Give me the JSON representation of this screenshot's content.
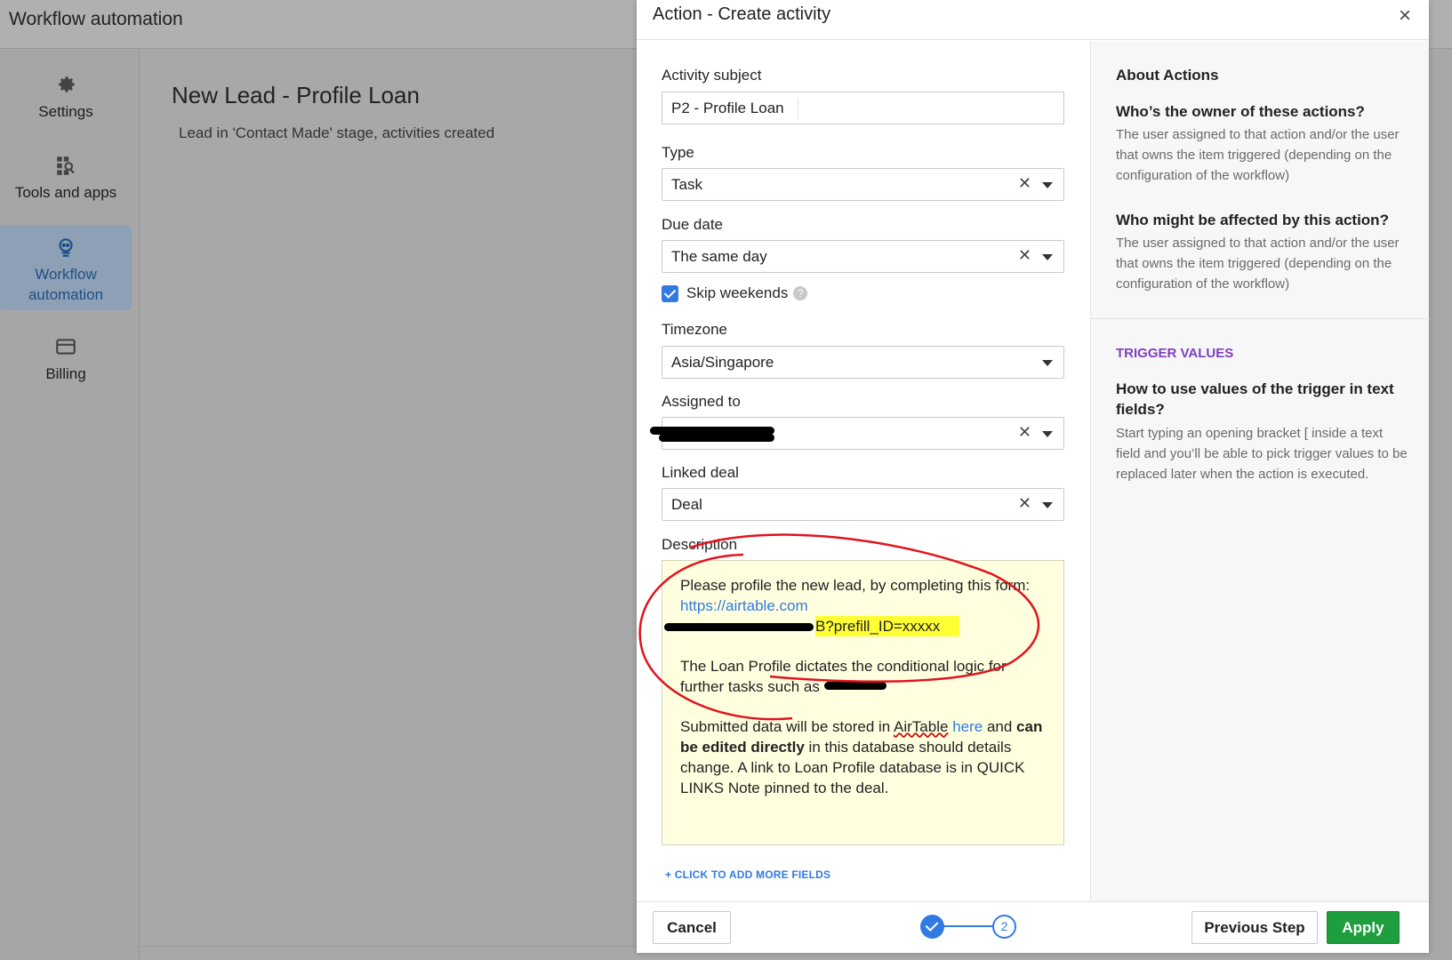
{
  "app": {
    "title": "Workflow automation"
  },
  "sidebar": {
    "items": [
      {
        "label": "Settings",
        "icon": "gear-icon"
      },
      {
        "label": "Tools and apps",
        "icon": "tools-icon"
      },
      {
        "label": "Workflow\nautomation",
        "icon": "workflow-icon",
        "active": true
      },
      {
        "label": "Billing",
        "icon": "card-icon"
      }
    ]
  },
  "main": {
    "title": "New Lead - Profile Loan",
    "subtitle": "Lead in 'Contact Made' stage, activities created"
  },
  "modal": {
    "title": "Action - Create activity",
    "close": "×",
    "form": {
      "subject_label": "Activity subject",
      "subject_value": "P2 - Profile Loan",
      "type_label": "Type",
      "type_value": "Task",
      "due_label": "Due date",
      "due_value": "The same day",
      "skip_label": "Skip weekends",
      "skip_checked": true,
      "timezone_label": "Timezone",
      "timezone_value": "Asia/Singapore",
      "assigned_label": "Assigned to",
      "linked_label": "Linked deal",
      "linked_value": "Deal",
      "desc_label": "Description",
      "desc_line1": "Please profile the new lead, by completing this form:",
      "desc_link": "https://airtable.com",
      "desc_highlight": "B?prefill_ID=xxxxx",
      "desc_para2": "The Loan Profile dictates the conditional logic for further tasks such as",
      "desc_para3_a": "Submitted data will be stored in ",
      "desc_para3_airtable": "AirTable",
      "desc_para3_here": "here",
      "desc_para3_b": " and ",
      "desc_para3_bold": "can be edited directly",
      "desc_para3_c": " in this database should details change. A link to Loan Profile database is in QUICK LINKS Note pinned to the deal.",
      "add_more": "+ CLICK TO ADD MORE FIELDS"
    },
    "about": {
      "heading": "About Actions",
      "q1": "Who’s the owner of these actions?",
      "a1": "The user assigned to that action and/or the user that owns the item triggered (depending on the configuration of the workflow)",
      "q2": "Who might be affected by this action?",
      "a2": "The user assigned to that action and/or the user that owns the item triggered (depending on the configuration of the workflow)",
      "trigger_heading": "TRIGGER VALUES",
      "q3": "How to use values of the trigger in text fields?",
      "a3": "Start typing an opening bracket [ inside a text field and you’ll be able to pick trigger values to be replaced later when the action is executed."
    },
    "footer": {
      "cancel": "Cancel",
      "step2": "2",
      "previous": "Previous Step",
      "apply": "Apply"
    }
  },
  "colors": {
    "accent": "#317ae2",
    "apply": "#1e9e3c",
    "trigger": "#7f3fbf",
    "highlight": "#ffff33"
  }
}
